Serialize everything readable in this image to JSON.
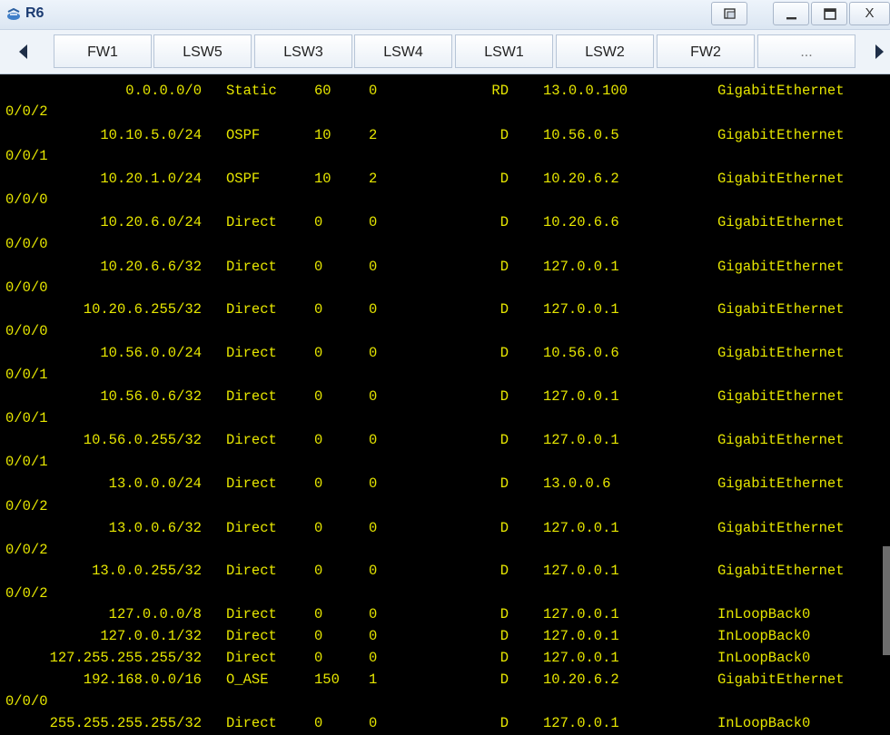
{
  "window": {
    "title": "R6",
    "icon": "router-app-icon",
    "controls": {
      "restore": "restore-icon",
      "minimize": "minimize-icon",
      "maximize": "maximize-icon",
      "close": "X"
    }
  },
  "tabs": {
    "items": [
      "FW1",
      "LSW5",
      "LSW3",
      "LSW4",
      "LSW1",
      "LSW2",
      "FW2",
      "..."
    ],
    "prev_icon": "chevron-left-icon",
    "next_icon": "chevron-right-icon"
  },
  "routing_table": {
    "rows": [
      {
        "dest": "0.0.0.0/0",
        "proto": "Static",
        "pre": "60",
        "cost": "0",
        "flags": "RD",
        "nexthop": "13.0.0.100",
        "iface": "GigabitEthernet",
        "iface_cont": "0/0/2"
      },
      {
        "dest": "10.10.5.0/24",
        "proto": "OSPF",
        "pre": "10",
        "cost": "2",
        "flags": "D",
        "nexthop": "10.56.0.5",
        "iface": "GigabitEthernet",
        "iface_cont": "0/0/1"
      },
      {
        "dest": "10.20.1.0/24",
        "proto": "OSPF",
        "pre": "10",
        "cost": "2",
        "flags": "D",
        "nexthop": "10.20.6.2",
        "iface": "GigabitEthernet",
        "iface_cont": "0/0/0"
      },
      {
        "dest": "10.20.6.0/24",
        "proto": "Direct",
        "pre": "0",
        "cost": "0",
        "flags": "D",
        "nexthop": "10.20.6.6",
        "iface": "GigabitEthernet",
        "iface_cont": "0/0/0"
      },
      {
        "dest": "10.20.6.6/32",
        "proto": "Direct",
        "pre": "0",
        "cost": "0",
        "flags": "D",
        "nexthop": "127.0.0.1",
        "iface": "GigabitEthernet",
        "iface_cont": "0/0/0"
      },
      {
        "dest": "10.20.6.255/32",
        "proto": "Direct",
        "pre": "0",
        "cost": "0",
        "flags": "D",
        "nexthop": "127.0.0.1",
        "iface": "GigabitEthernet",
        "iface_cont": "0/0/0"
      },
      {
        "dest": "10.56.0.0/24",
        "proto": "Direct",
        "pre": "0",
        "cost": "0",
        "flags": "D",
        "nexthop": "10.56.0.6",
        "iface": "GigabitEthernet",
        "iface_cont": "0/0/1"
      },
      {
        "dest": "10.56.0.6/32",
        "proto": "Direct",
        "pre": "0",
        "cost": "0",
        "flags": "D",
        "nexthop": "127.0.0.1",
        "iface": "GigabitEthernet",
        "iface_cont": "0/0/1"
      },
      {
        "dest": "10.56.0.255/32",
        "proto": "Direct",
        "pre": "0",
        "cost": "0",
        "flags": "D",
        "nexthop": "127.0.0.1",
        "iface": "GigabitEthernet",
        "iface_cont": "0/0/1"
      },
      {
        "dest": "13.0.0.0/24",
        "proto": "Direct",
        "pre": "0",
        "cost": "0",
        "flags": "D",
        "nexthop": "13.0.0.6",
        "iface": "GigabitEthernet",
        "iface_cont": "0/0/2"
      },
      {
        "dest": "13.0.0.6/32",
        "proto": "Direct",
        "pre": "0",
        "cost": "0",
        "flags": "D",
        "nexthop": "127.0.0.1",
        "iface": "GigabitEthernet",
        "iface_cont": "0/0/2"
      },
      {
        "dest": "13.0.0.255/32",
        "proto": "Direct",
        "pre": "0",
        "cost": "0",
        "flags": "D",
        "nexthop": "127.0.0.1",
        "iface": "GigabitEthernet",
        "iface_cont": "0/0/2"
      },
      {
        "dest": "127.0.0.0/8",
        "proto": "Direct",
        "pre": "0",
        "cost": "0",
        "flags": "D",
        "nexthop": "127.0.0.1",
        "iface": "InLoopBack0",
        "iface_cont": ""
      },
      {
        "dest": "127.0.0.1/32",
        "proto": "Direct",
        "pre": "0",
        "cost": "0",
        "flags": "D",
        "nexthop": "127.0.0.1",
        "iface": "InLoopBack0",
        "iface_cont": ""
      },
      {
        "dest": "127.255.255.255/32",
        "proto": "Direct",
        "pre": "0",
        "cost": "0",
        "flags": "D",
        "nexthop": "127.0.0.1",
        "iface": "InLoopBack0",
        "iface_cont": ""
      },
      {
        "dest": "192.168.0.0/16",
        "proto": "O_ASE",
        "pre": "150",
        "cost": "1",
        "flags": "D",
        "nexthop": "10.20.6.2",
        "iface": "GigabitEthernet",
        "iface_cont": "0/0/0"
      },
      {
        "dest": "255.255.255.255/32",
        "proto": "Direct",
        "pre": "0",
        "cost": "0",
        "flags": "D",
        "nexthop": "127.0.0.1",
        "iface": "InLoopBack0",
        "iface_cont": ""
      }
    ]
  },
  "colors": {
    "terminal_bg": "#000000",
    "terminal_text": "#e6e600",
    "title_text": "#1b3b72"
  }
}
